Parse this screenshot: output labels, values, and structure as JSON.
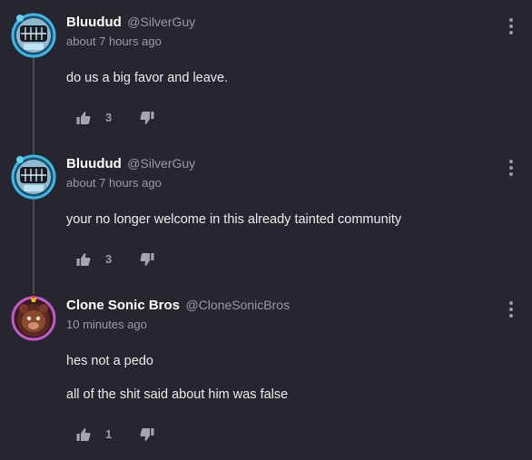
{
  "comments": [
    {
      "display_name": "Bluudud",
      "handle": "@SilverGuy",
      "timestamp": "about 7 hours ago",
      "lines": [
        "do us a big favor and leave."
      ],
      "like_count": "3",
      "avatar_ring_color": "#3fb7e6",
      "avatar_icon": "goggles-avatar"
    },
    {
      "display_name": "Bluudud",
      "handle": "@SilverGuy",
      "timestamp": "about 7 hours ago",
      "lines": [
        "your no longer welcome in this already tainted community"
      ],
      "like_count": "3",
      "avatar_ring_color": "#3fb7e6",
      "avatar_icon": "goggles-avatar"
    },
    {
      "display_name": "Clone Sonic Bros",
      "handle": "@CloneSonicBros",
      "timestamp": "10 minutes ago",
      "lines": [
        "hes not a pedo",
        "all of the shit said about him was false"
      ],
      "like_count": "1",
      "avatar_ring_color": "#c05acc",
      "avatar_icon": "bear-avatar"
    }
  ],
  "icons": {
    "like": "thumbs-up-icon",
    "dislike": "thumbs-down-icon",
    "menu": "more-vertical-icon"
  },
  "colors": {
    "background": "#26262e",
    "name": "#ffffff",
    "muted": "#9a9aa6",
    "thread_line": "#4a4a55"
  }
}
